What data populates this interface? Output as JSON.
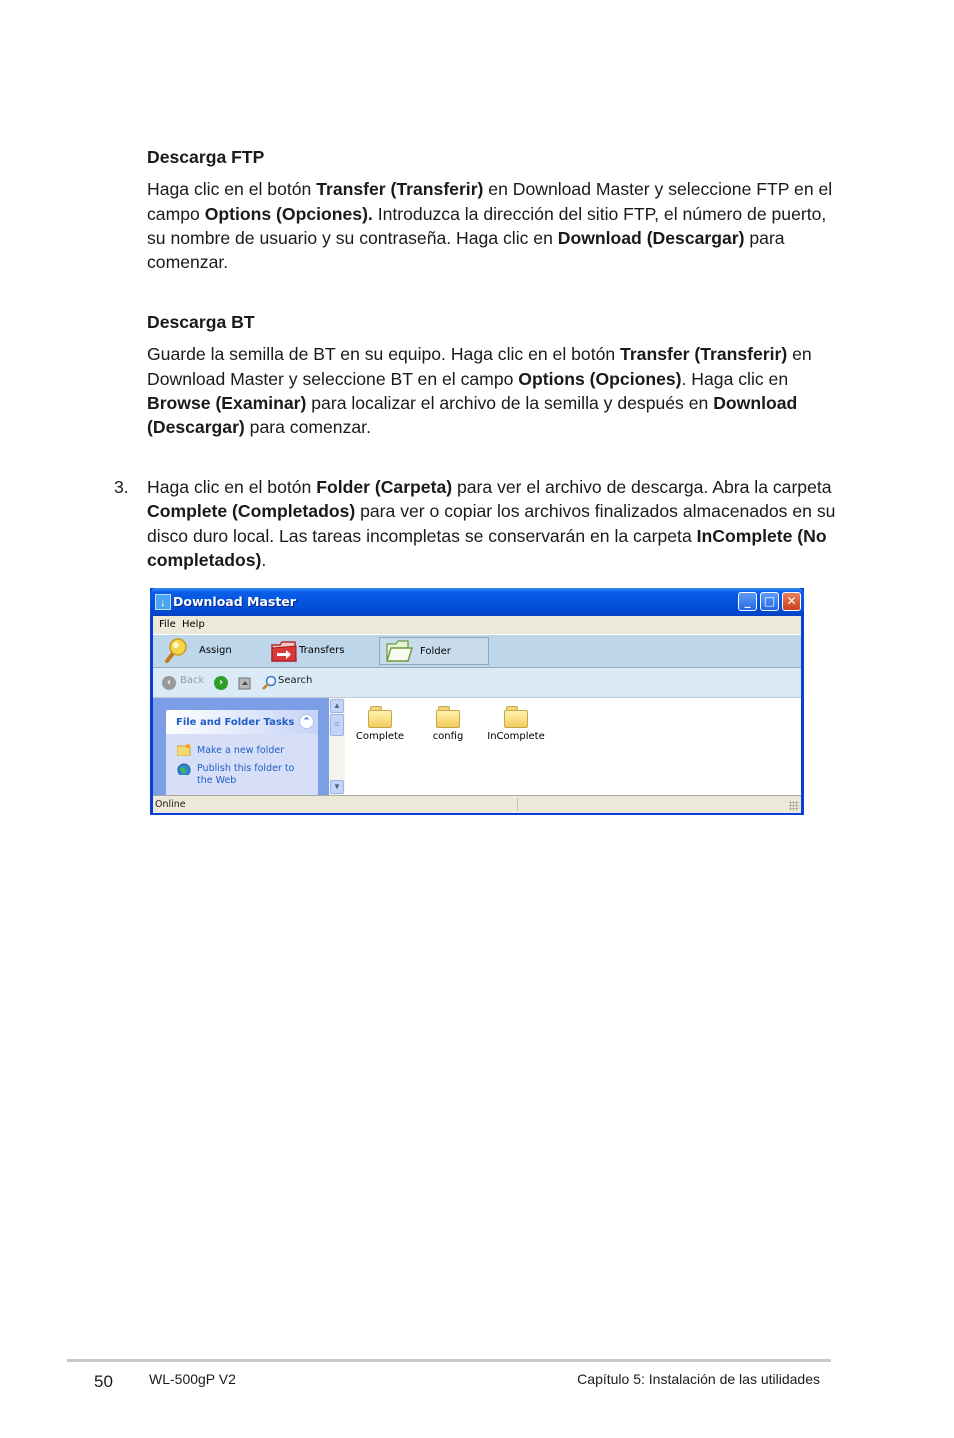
{
  "sections": {
    "ftp": {
      "heading": "Descarga FTP",
      "p": [
        {
          "t": "Haga clic en el botón ",
          "b": false
        },
        {
          "t": "Transfer (Transferir)",
          "b": true
        },
        {
          "t": " en Download Master y seleccione FTP en el campo ",
          "b": false
        },
        {
          "t": "Options (Opciones).",
          "b": true
        },
        {
          "t": " Introduzca la dirección del sitio FTP, el número de puerto, su nombre de usuario y su contraseña. Haga clic en ",
          "b": false
        },
        {
          "t": "Download (Descargar)",
          "b": true
        },
        {
          "t": " para comenzar.",
          "b": false
        }
      ]
    },
    "bt": {
      "heading": "Descarga BT",
      "p": [
        {
          "t": "Guarde la semilla de BT en su equipo. Haga clic en el botón ",
          "b": false
        },
        {
          "t": "Transfer (Transferir)",
          "b": true
        },
        {
          "t": " en Download Master y seleccione BT en el campo ",
          "b": false
        },
        {
          "t": "Options (Opciones)",
          "b": true
        },
        {
          "t": ". Haga clic en ",
          "b": false
        },
        {
          "t": "Browse (Examinar)",
          "b": true
        },
        {
          "t": " para localizar el archivo de la semilla y después en ",
          "b": false
        },
        {
          "t": "Download (Descargar)",
          "b": true
        },
        {
          "t": " para comenzar.",
          "b": false
        }
      ]
    },
    "step3": {
      "number": "3.",
      "p": [
        {
          "t": "Haga clic en el botón ",
          "b": false
        },
        {
          "t": "Folder (Carpeta)",
          "b": true
        },
        {
          "t": " para ver el archivo de descarga. Abra la carpeta ",
          "b": false
        },
        {
          "t": "Complete (Completados)",
          "b": true
        },
        {
          "t": " para ver o copiar los archivos finalizados almacenados en su disco duro local. Las tareas incompletas se conservarán en la carpeta ",
          "b": false
        },
        {
          "t": "InComplete (No completados)",
          "b": true
        },
        {
          "t": ".",
          "b": false
        }
      ]
    }
  },
  "window": {
    "title": "Download Master",
    "app_icon": "↓",
    "controls": {
      "minimize": "_",
      "maximize": "□",
      "close": "✕"
    },
    "menu": [
      "File",
      "Help"
    ],
    "toolbar": [
      {
        "label": "Assign",
        "icon": "magnifier-key-icon",
        "active": false
      },
      {
        "label": "Transfers",
        "icon": "transfers-folder-icon",
        "active": false
      },
      {
        "label": "Folder",
        "icon": "open-folder-icon",
        "active": true
      }
    ],
    "nav": {
      "back": "Back",
      "search": "Search"
    },
    "tasks": {
      "title": "File and Folder Tasks",
      "collapse": "⌃",
      "items": [
        "Make a new folder",
        "Publish this folder to the Web"
      ]
    },
    "folders": [
      "Complete",
      "config",
      "InComplete"
    ],
    "status": "Online"
  },
  "footer": {
    "page": "50",
    "model": "WL-500gP V2",
    "chapter": "Capítulo 5: Instalación de las utilidades"
  }
}
